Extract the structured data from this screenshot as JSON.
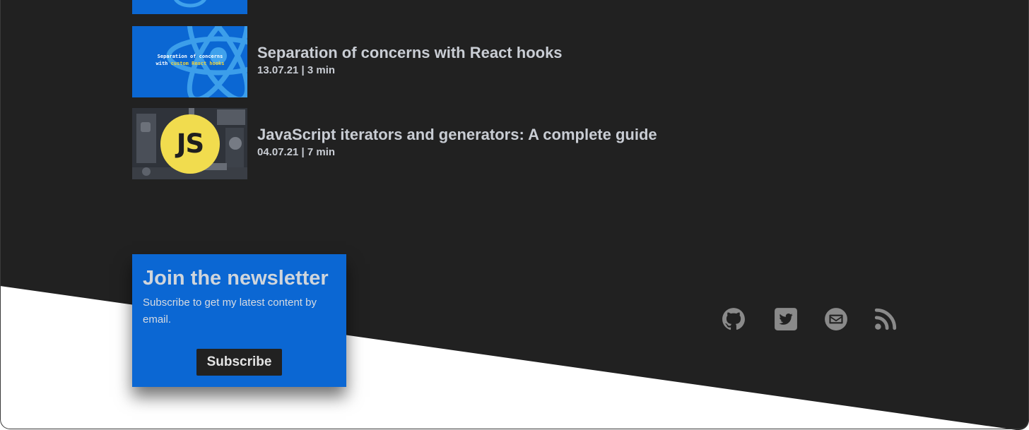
{
  "posts": [
    {
      "thumb_line1": "Separation of concerns",
      "thumb_line2_prefix": "with ",
      "thumb_line2_highlight": "custom React hooks",
      "title": "Separation of concerns with React hooks",
      "meta": "13.07.21 | 3 min"
    },
    {
      "thumb_badge": "JS",
      "title": "JavaScript iterators and generators: A complete guide",
      "meta": "04.07.21 | 7 min"
    }
  ],
  "newsletter": {
    "title": "Join the newsletter",
    "description": "Subscribe to get my latest content by email.",
    "button_label": "Subscribe"
  },
  "social": [
    {
      "icon": "github-icon"
    },
    {
      "icon": "twitter-icon"
    },
    {
      "icon": "mail-icon"
    },
    {
      "icon": "rss-icon"
    }
  ],
  "colors": {
    "background_dark": "#212121",
    "background_light": "#ffffff",
    "accent_blue": "#0b67d3",
    "text_light": "#c9cdd4",
    "js_yellow": "#f1dc4e",
    "highlight_yellow": "#f0d33a",
    "icon_gray": "#8a8a8a"
  }
}
